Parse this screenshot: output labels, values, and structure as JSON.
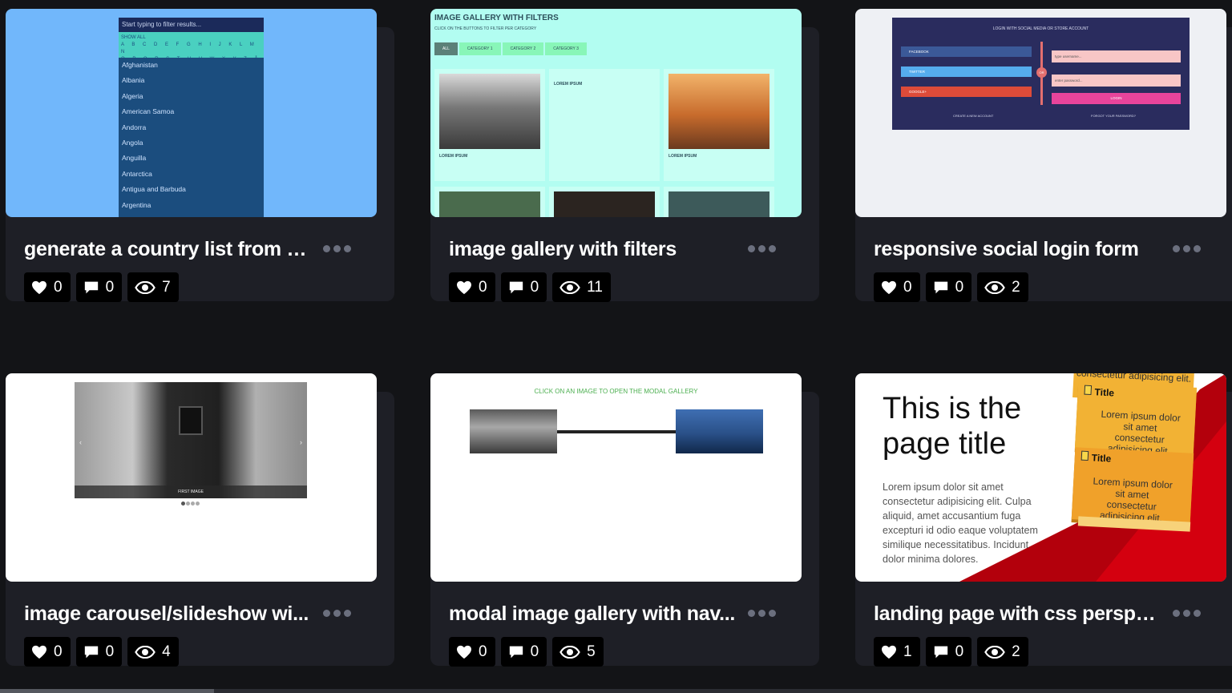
{
  "cards": [
    {
      "title": "generate a country list from a...",
      "likes": "0",
      "comments": "0",
      "views": "7",
      "preview": {
        "search_placeholder": "Start typing to filter results...",
        "show_all": "SHOW ALL",
        "letters_row1": "A B C D E F G H I J K L M N",
        "letters_row2": "O P Q R S T U V W X Y Z Å",
        "countries": [
          "Afghanistan",
          "Albania",
          "Algeria",
          "American Samoa",
          "Andorra",
          "Angola",
          "Anguilla",
          "Antarctica",
          "Antigua and Barbuda",
          "Argentina"
        ]
      }
    },
    {
      "title": "image gallery with filters",
      "likes": "0",
      "comments": "0",
      "views": "11",
      "preview": {
        "heading": "IMAGE GALLERY WITH FILTERS",
        "sub": "CLICK ON THE BUTTONS TO FILTER PER CATEGORY",
        "buttons": [
          "ALL",
          "CATEGORY 1",
          "CATEGORY 2",
          "CATEGORY 3"
        ],
        "tile_title": "LOREM IPSUM"
      }
    },
    {
      "title": "responsive social login form",
      "likes": "0",
      "comments": "0",
      "views": "2",
      "preview": {
        "heading": "LOGIN WITH SOCIAL MEDIA OR STORE ACCOUNT",
        "facebook": "FACEBOOK",
        "twitter": "TWITTER",
        "google": "GOOGLE+",
        "or": "OR",
        "user_placeholder": "type username...",
        "pass_placeholder": "enter password...",
        "login": "LOGIN",
        "create": "CREATE A NEW ACCOUNT",
        "forgot": "FORGOT YOUR PASSWORD?"
      }
    },
    {
      "title": "image carousel/slideshow wi...",
      "likes": "0",
      "comments": "0",
      "views": "4",
      "preview": {
        "caption": "FIRST IMAGE"
      }
    },
    {
      "title": "modal image gallery with nav...",
      "likes": "0",
      "comments": "0",
      "views": "5",
      "preview": {
        "heading": "CLICK ON AN IMAGE TO OPEN THE MODAL GALLERY"
      }
    },
    {
      "title": "landing page with css perspec...",
      "likes": "1",
      "comments": "0",
      "views": "2",
      "preview": {
        "page_title_line1": "This is the",
        "page_title_line2": "page title",
        "lorem": "Lorem ipsum dolor sit amet consectetur adipisicing elit. Culpa aliquid, amet accusantium fuga excepturi id odio eaque voluptatem similique necessitatibus. Incidunt dolor minima dolores.",
        "note_title": "Title",
        "note_text": "Lorem ipsum dolor sit amet consectetur adipisicing elit.",
        "note_top": "consectetur adipisicing elit."
      }
    }
  ],
  "colors": {
    "background": "#131417",
    "card": "#1e1f26",
    "stat_bg": "#000000",
    "dots": "#6b6f7e"
  }
}
